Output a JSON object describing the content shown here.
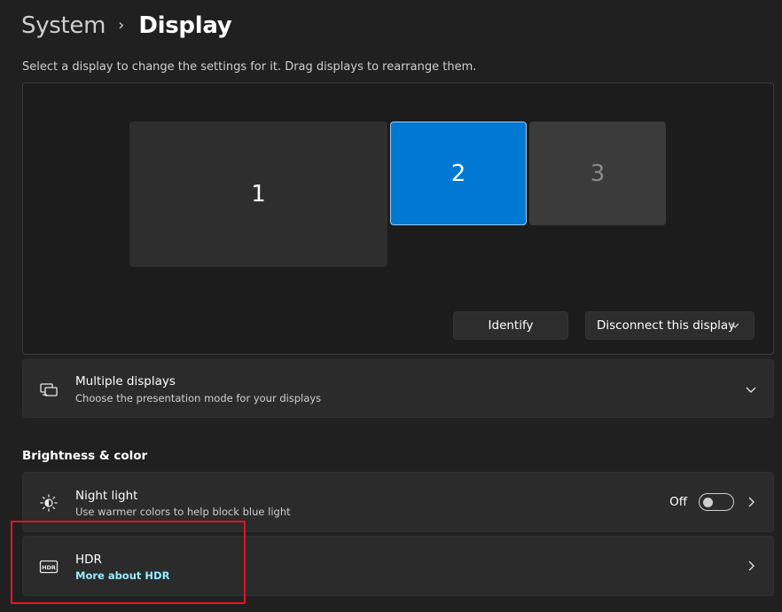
{
  "breadcrumb": {
    "parent": "System",
    "separator": "›",
    "current": "Display"
  },
  "hint": "Select a display to change the settings for it. Drag displays to rearrange them.",
  "displays": [
    {
      "label": "1",
      "selected": false
    },
    {
      "label": "2",
      "selected": true
    },
    {
      "label": "3",
      "selected": false
    }
  ],
  "buttons": {
    "identify": "Identify",
    "disconnect": "Disconnect this display"
  },
  "multiple_displays": {
    "title": "Multiple displays",
    "subtitle": "Choose the presentation mode for your displays",
    "icon": "multiple-displays-icon"
  },
  "brightness_section": {
    "label": "Brightness & color"
  },
  "night_light": {
    "title": "Night light",
    "subtitle": "Use warmer colors to help block blue light",
    "state": "Off",
    "icon": "night-light-icon"
  },
  "hdr": {
    "title": "HDR",
    "link": "More about HDR",
    "icon": "hdr-icon"
  },
  "colors": {
    "background": "#202020",
    "card": "#2b2b2b",
    "accent": "#0078d4",
    "link": "#99ebff",
    "highlight": "#e81123"
  }
}
